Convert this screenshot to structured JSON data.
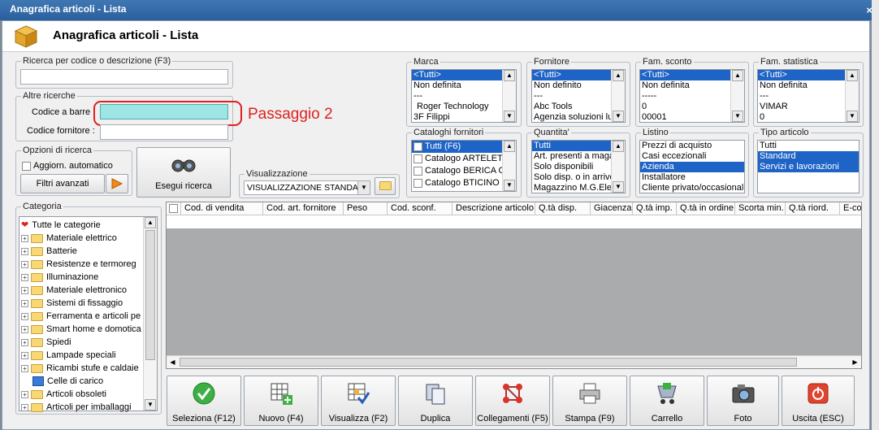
{
  "window": {
    "title": "Anagrafica articoli  - Lista",
    "close": "×"
  },
  "header": {
    "title": "Anagrafica articoli  - Lista"
  },
  "search": {
    "code_desc_legend": "Ricerca per codice o descrizione (F3)",
    "code_desc_value": "",
    "altre_legend": "Altre ricerche",
    "barcode_label": "Codice a barre",
    "supplier_code_label": "Codice fornitore :",
    "annotation": "Passaggio 2"
  },
  "options": {
    "legend": "Opzioni di ricerca",
    "auto_update": "Aggiorn. automatico",
    "advanced_filters": "Filtri avanzati",
    "execute": "Esegui ricerca"
  },
  "view": {
    "legend": "Visualizzazione",
    "value": "VISUALIZZAZIONE STANDA"
  },
  "marca": {
    "legend": "Marca",
    "items": [
      "<Tutti>",
      "Non definita",
      "---",
      "Roger Technology",
      "3F Filippi"
    ]
  },
  "fornitore": {
    "legend": "Fornitore",
    "items": [
      "<Tutti>",
      "Non definito",
      "---",
      "Abc Tools",
      "Agenzia soluzioni lum"
    ]
  },
  "fam_sconto": {
    "legend": "Fam. sconto",
    "items": [
      "<Tutti>",
      "Non definita",
      "-----",
      "0",
      "00001"
    ]
  },
  "fam_statistica": {
    "legend": "Fam. statistica",
    "items": [
      "<Tutti>",
      "Non definita",
      "---",
      "VIMAR",
      "0"
    ]
  },
  "cataloghi": {
    "legend": "Cataloghi fornitori",
    "items": [
      "Tutti (F6)",
      "Catalogo ARTELETA",
      "Catalogo BERICA C/",
      "Catalogo BTICINO S"
    ]
  },
  "quantita": {
    "legend": "Quantita'",
    "items": [
      "Tutti",
      "Art. presenti a maga",
      "Solo disponibili",
      "Solo disp. o in arrivo",
      "Magazzino M.G.Elect"
    ]
  },
  "listino": {
    "legend": "Listino",
    "items": [
      "Prezzi di acquisto",
      "Casi eccezionali",
      "Azienda",
      "Installatore",
      "Cliente privato/occasionale"
    ]
  },
  "tipo": {
    "legend": "Tipo articolo",
    "items": [
      "Tutti",
      "Standard",
      "Servizi e lavorazioni"
    ]
  },
  "categoria": {
    "legend": "Categoria",
    "items": [
      "Tutte le categorie",
      "Materiale elettrico",
      "Batterie",
      "Resistenze e termoreg",
      "Illuminazione",
      "Materiale elettronico",
      "Sistemi di fissaggio",
      "Ferramenta e articoli pe",
      "Smart home e domotica",
      "Spiedi",
      "Lampade speciali",
      "Ricambi stufe e caldaie",
      "Celle di carico",
      "Articoli obsoleti",
      "Articoli per imballaggi"
    ]
  },
  "grid": {
    "columns": [
      "Cod. di vendita",
      "Cod. art. fornitore",
      "Peso",
      "Cod. sconf.",
      "Descrizione articolo",
      "Q.tà disp.",
      "Giacenza",
      "Q.tà imp.",
      "Q.tà in ordine",
      "Scorta min.",
      "Q.tà riord.",
      "E-co"
    ]
  },
  "toolbar": {
    "seleziona": "Seleziona (F12)",
    "nuovo": "Nuovo (F4)",
    "visualizza": "Visualizza (F2)",
    "duplica": "Duplica",
    "collegamenti": "Collegamenti (F5)",
    "stampa": "Stampa (F9)",
    "carrello": "Carrello",
    "foto": "Foto",
    "uscita": "Uscita (ESC)"
  },
  "colors": {
    "title_bar": "#2f68a8",
    "selection": "#1e63c6",
    "annotation": "#e02020"
  }
}
